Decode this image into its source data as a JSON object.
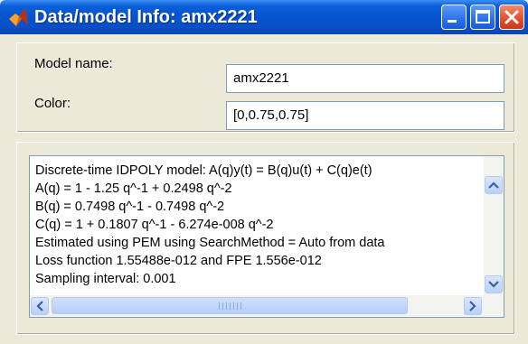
{
  "window": {
    "title": "Data/model Info: amx2221"
  },
  "fields": {
    "model_name_label": "Model name:",
    "model_name_value": "amx2221",
    "color_label": "Color:",
    "color_value": "[0,0.75,0.75]"
  },
  "info": {
    "lines": [
      "Discrete-time IDPOLY model: A(q)y(t) = B(q)u(t) + C(q)e(t)",
      "A(q) = 1 - 1.25 q^-1 + 0.2498 q^-2",
      "B(q) = 0.7498 q^-1 - 0.7498 q^-2",
      "C(q) = 1 + 0.1807 q^-1 - 6.274e-008 q^-2",
      "Estimated using PEM using SearchMethod = Auto from data",
      "Loss function 1.55488e-012 and FPE 1.556e-012",
      "Sampling interval: 0.001"
    ]
  },
  "icons": {
    "app": "matlab-logo-icon",
    "minimize": "minimize-icon",
    "maximize": "maximize-icon",
    "close": "close-icon"
  }
}
